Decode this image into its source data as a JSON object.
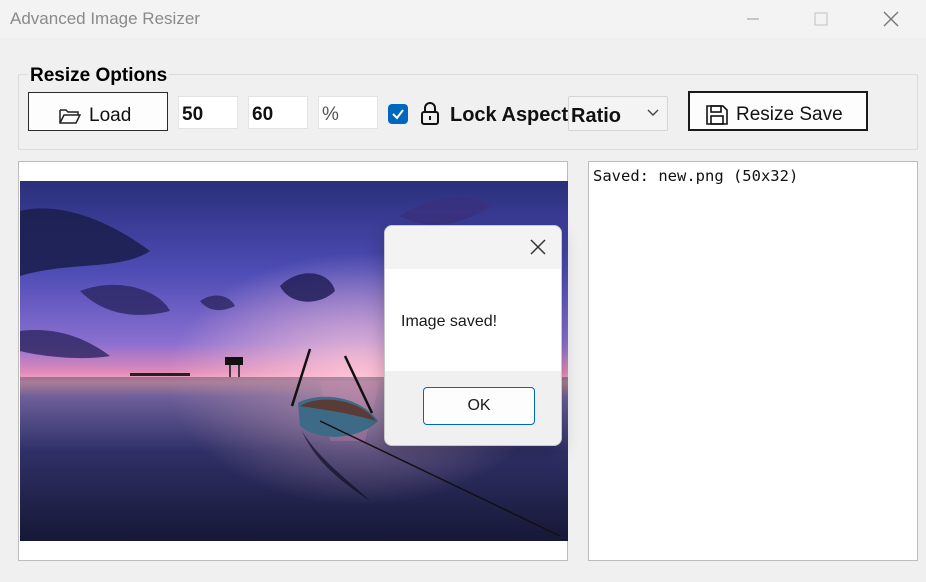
{
  "window": {
    "title": "Advanced Image Resizer"
  },
  "options": {
    "group_label": "Resize Options",
    "load_label": "Load",
    "width_value": "50",
    "height_value": "60",
    "unit_value": "%",
    "lock_checked": true,
    "lock_label": "Lock Aspect Ratio",
    "dropdown_value": "Ratio",
    "save_label": "Resize  Save"
  },
  "log": {
    "line": "Saved: new.png (50x32)"
  },
  "dialog": {
    "message": "Image saved!",
    "ok_label": "OK"
  },
  "colors": {
    "accent": "#0067c0"
  }
}
